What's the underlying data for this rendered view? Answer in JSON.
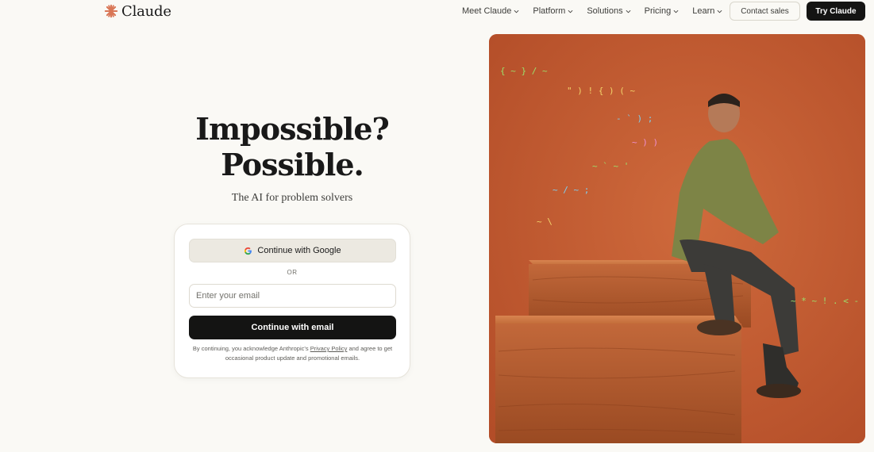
{
  "header": {
    "brand": "Claude",
    "brand_color": "#d97757",
    "nav": [
      {
        "label": "Meet Claude"
      },
      {
        "label": "Platform"
      },
      {
        "label": "Solutions"
      },
      {
        "label": "Pricing"
      },
      {
        "label": "Learn"
      }
    ],
    "contact_label": "Contact sales",
    "try_label": "Try Claude"
  },
  "hero": {
    "title_line1": "Impossible?",
    "title_line2": "Possible.",
    "subtitle": "The AI for problem solvers"
  },
  "auth": {
    "google_label": "Continue with Google",
    "or_label": "OR",
    "email_placeholder": "Enter your email",
    "email_value": "",
    "email_button": "Continue with email",
    "legal_prefix": "By continuing, you acknowledge Anthropic's",
    "legal_link": "Privacy Policy",
    "legal_suffix": "and agree to get occasional product update and promotional emails."
  },
  "colors": {
    "background": "#faf9f5",
    "primary_button": "#141413",
    "photo_background": "#c45a2f"
  }
}
